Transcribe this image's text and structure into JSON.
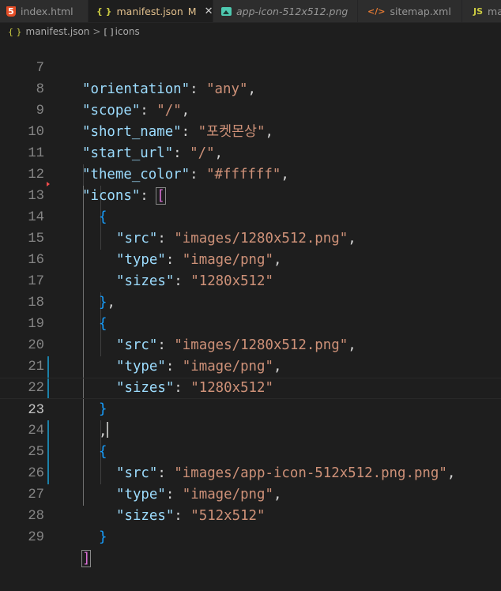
{
  "tabs": [
    {
      "label": "index.html",
      "icon": "html5-icon",
      "icon_glyph": "5"
    },
    {
      "label": "manifest.json",
      "icon": "json-braces-icon",
      "icon_glyph": "{ }",
      "status": "M",
      "active": true
    },
    {
      "label": "app-icon-512x512.png",
      "icon": "image-icon",
      "icon_glyph": ""
    },
    {
      "label": "sitemap.xml",
      "icon": "xml-icon",
      "icon_glyph": "</>"
    },
    {
      "label": "ma",
      "icon": "js-icon",
      "icon_glyph": "JS"
    }
  ],
  "tab_close_glyph": "✕",
  "breadcrumb": {
    "file_icon": "{ }",
    "file": "manifest.json",
    "separator": ">",
    "symbol_icon": "[ ]",
    "symbol": "icons"
  },
  "editor": {
    "current_line": 23,
    "lines": [
      {
        "n": "7",
        "text": "\"orientation\": \"any\","
      },
      {
        "n": "8",
        "text": "\"scope\": \"/\","
      },
      {
        "n": "9",
        "text": "\"short_name\": \"포켓몬상\","
      },
      {
        "n": "10",
        "text": "\"start_url\": \"/\","
      },
      {
        "n": "11",
        "text": "\"theme_color\": \"#ffffff\","
      },
      {
        "n": "12",
        "text": "\"icons\": ["
      },
      {
        "n": "13",
        "text": "{"
      },
      {
        "n": "14",
        "text": "\"src\": \"images/1280x512.png\","
      },
      {
        "n": "15",
        "text": "\"type\": \"image/png\","
      },
      {
        "n": "16",
        "text": "\"sizes\": \"1280x512\""
      },
      {
        "n": "17",
        "text": "},"
      },
      {
        "n": "18",
        "text": "{"
      },
      {
        "n": "19",
        "text": "\"src\": \"images/1280x512.png\","
      },
      {
        "n": "20",
        "text": "\"type\": \"image/png\","
      },
      {
        "n": "21",
        "text": "\"sizes\": \"1280x512\""
      },
      {
        "n": "22",
        "text": "}"
      },
      {
        "n": "23",
        "text": ","
      },
      {
        "n": "24",
        "text": "{"
      },
      {
        "n": "25",
        "text": "\"src\": \"images/app-icon-512x512.png.png\","
      },
      {
        "n": "26",
        "text": "\"type\": \"image/png\","
      },
      {
        "n": "27",
        "text": "\"sizes\": \"512x512\""
      },
      {
        "n": "28",
        "text": "}"
      },
      {
        "n": "29",
        "text": "]"
      }
    ]
  },
  "colors": {
    "background": "#1e1e1e",
    "key": "#9cdcfe",
    "string": "#ce9178",
    "punctuation": "#d4d4d4",
    "bracket_level1": "#da70d6",
    "bracket_level2": "#179fff",
    "modified_tab": "#e2c08d",
    "gutter_modified": "#1b81a8"
  }
}
